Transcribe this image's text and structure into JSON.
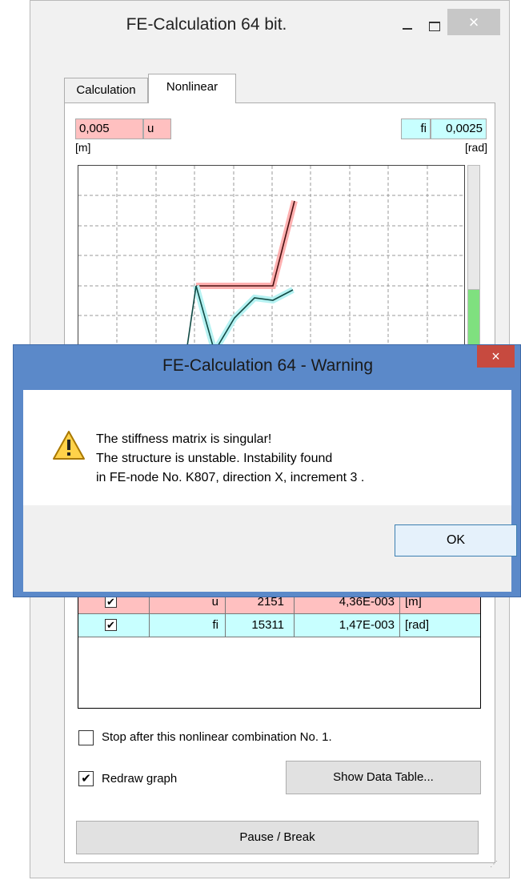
{
  "window": {
    "title": "FE-Calculation 64 bit.",
    "close_glyph": "×"
  },
  "tabs": [
    {
      "label": "Calculation"
    },
    {
      "label": "Nonlinear"
    }
  ],
  "nonlinear": {
    "u_value": "0,005",
    "u_label": "u",
    "u_unit": "[m]",
    "fi_label": "fi",
    "fi_value": "0,0025",
    "fi_unit": "[rad]",
    "side_bar_level": 0.48
  },
  "results": {
    "rows": [
      {
        "checked": "✔",
        "name": "u",
        "count": "2151",
        "value": "4,36E-003",
        "unit": "[m]"
      },
      {
        "checked": "✔",
        "name": "fi",
        "count": "15311",
        "value": "1,47E-003",
        "unit": "[rad]"
      }
    ]
  },
  "options": {
    "stop_label": "Stop after this nonlinear combination No. 1.",
    "redraw_label": "Redraw graph",
    "redraw_check": "✔",
    "show_table_label": "Show Data Table...",
    "pause_label": "Pause / Break"
  },
  "dialog": {
    "title": "FE-Calculation 64 - Warning",
    "close_glyph": "×",
    "line1": "The stiffness matrix is singular!",
    "line2": "The structure is unstable. Instability found",
    "line3": "in FE-node No. K807, direction X, increment 3 .",
    "ok_label": "OK",
    "icon": "warning-icon"
  },
  "colors": {
    "u_series": "#ffc0c0",
    "fi_series": "#c8ffff",
    "dialog_frame": "#5b89c9",
    "dialog_close": "#c74a3f"
  }
}
